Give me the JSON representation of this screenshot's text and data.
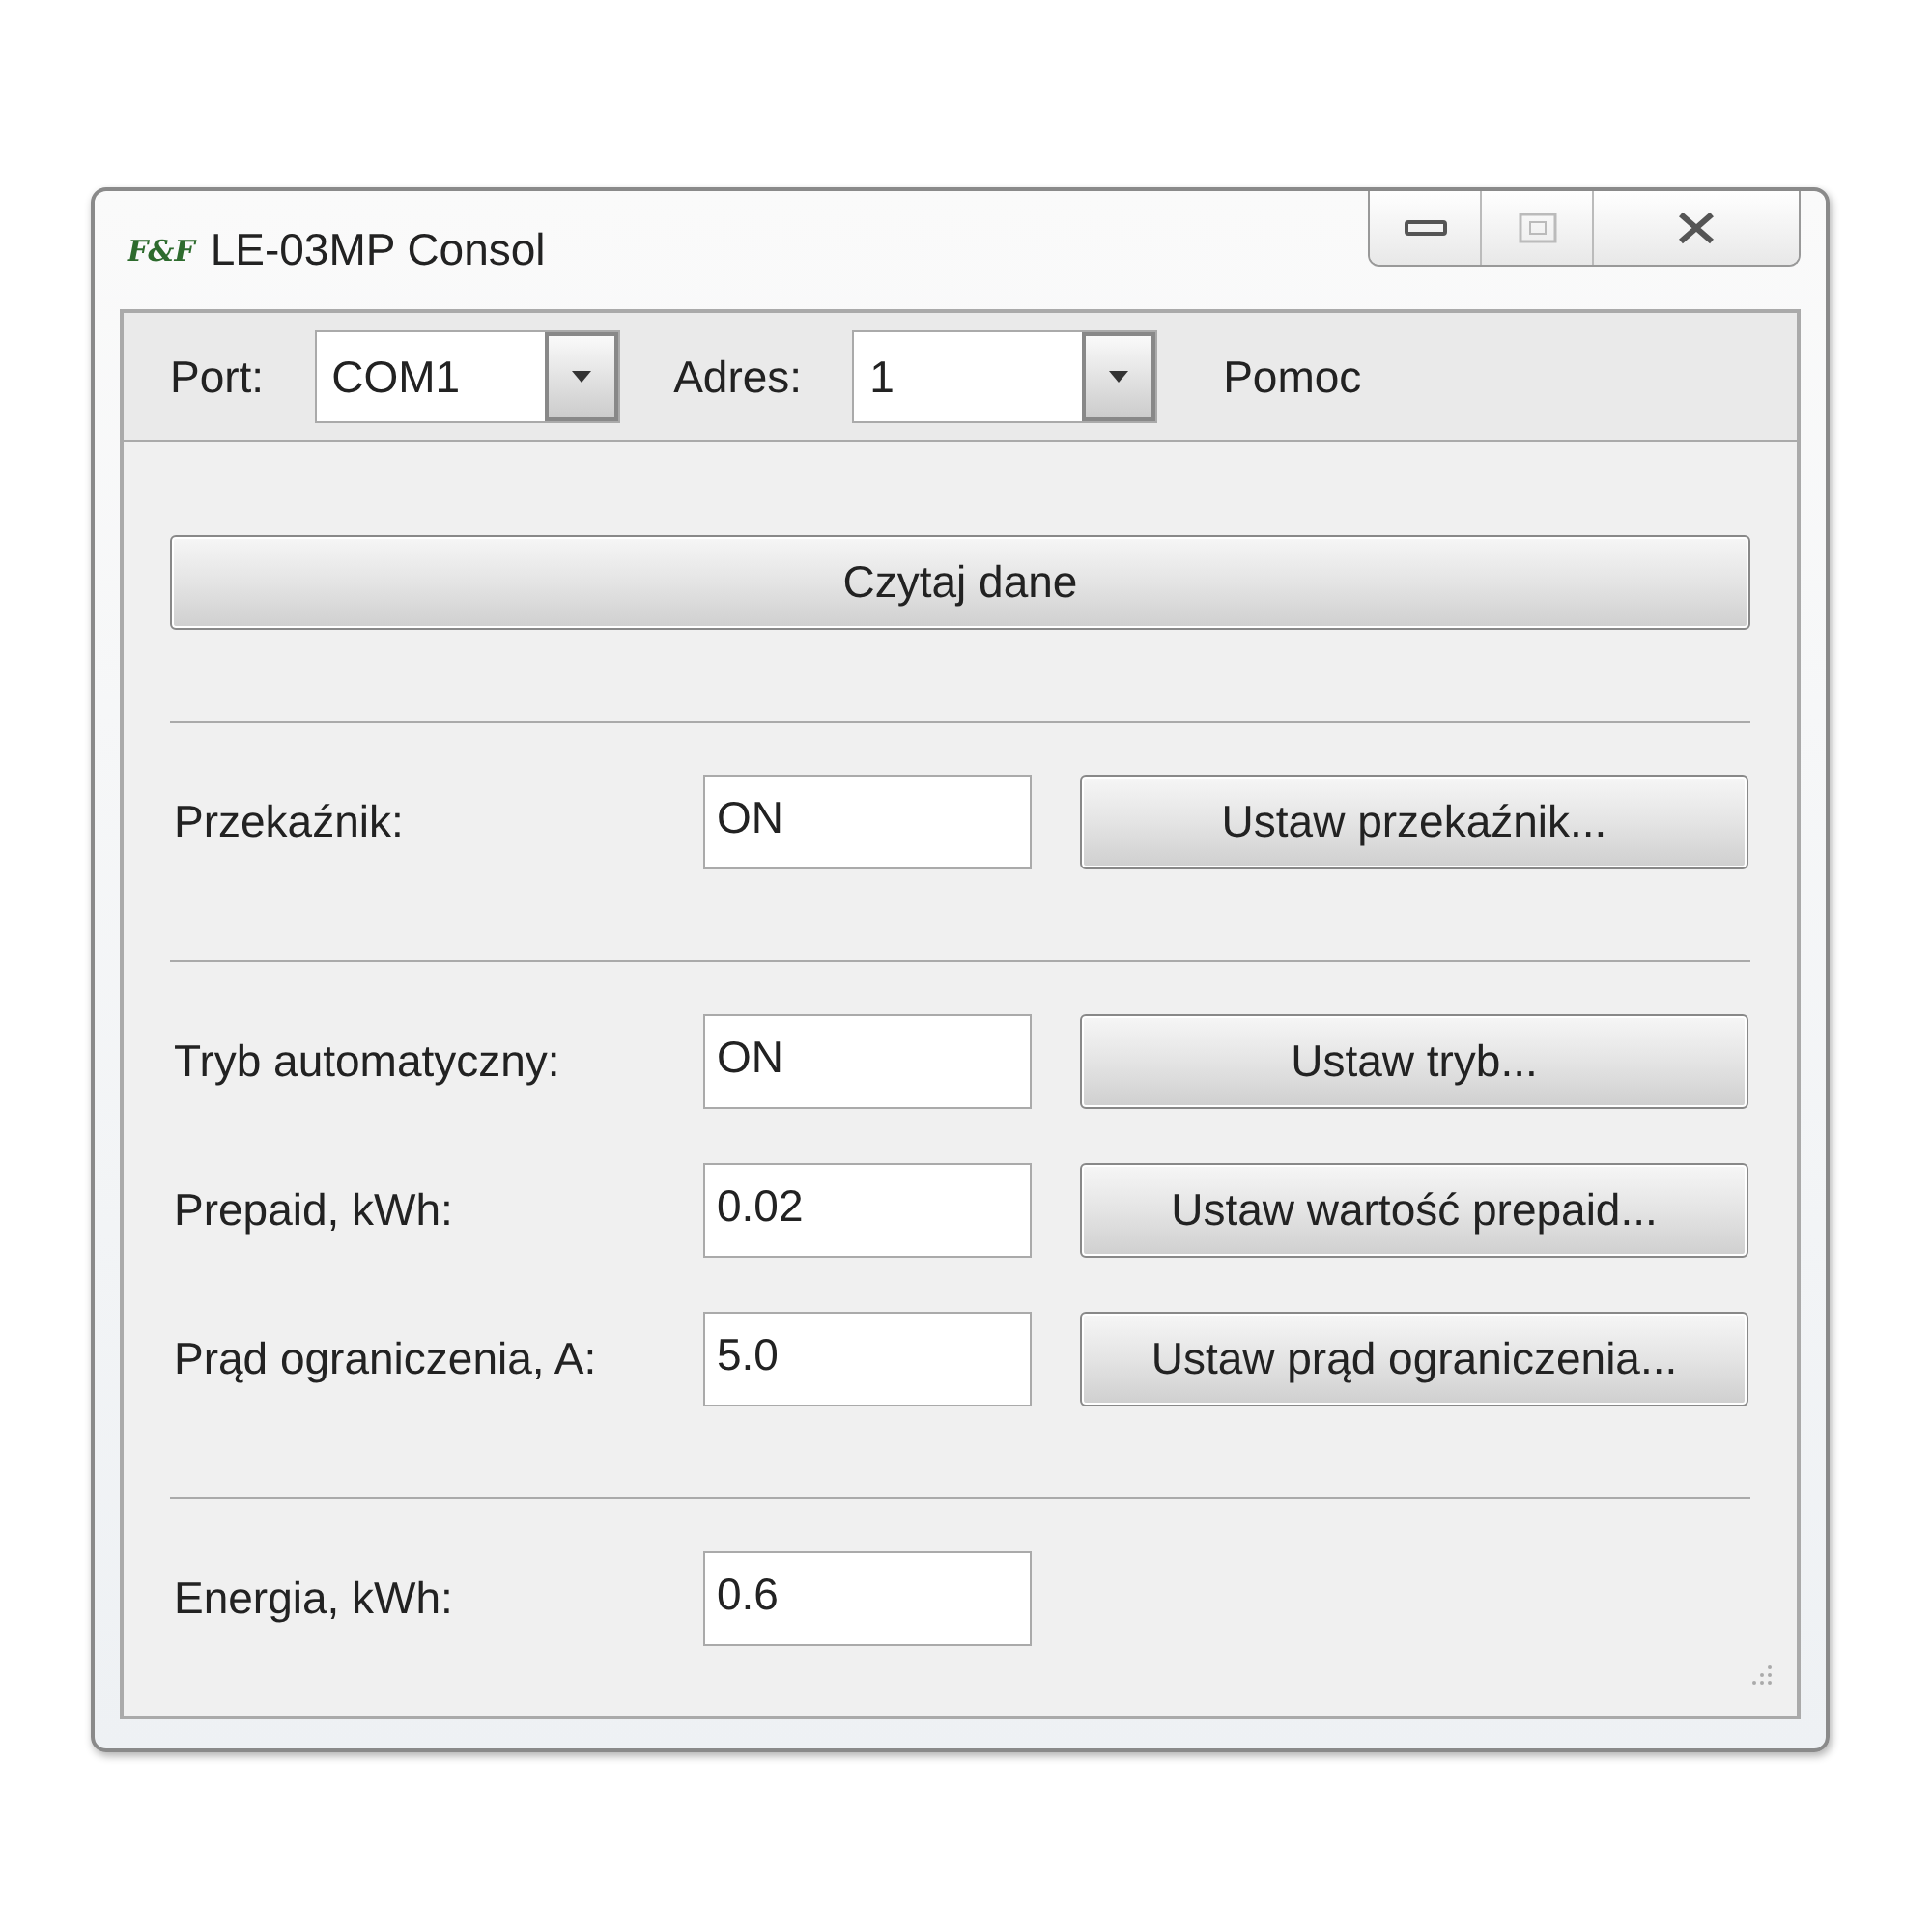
{
  "window": {
    "logo": "F&F",
    "title": "LE-03MP Consol"
  },
  "toolbar": {
    "port_label": "Port:",
    "port_value": "COM1",
    "address_label": "Adres:",
    "address_value": "1",
    "help": "Pomoc"
  },
  "read_button": "Czytaj dane",
  "sections": [
    [
      {
        "label": "Przekaźnik:",
        "value": "ON",
        "button": "Ustaw przekaźnik..."
      }
    ],
    [
      {
        "label": "Tryb automatyczny:",
        "value": "ON",
        "button": "Ustaw tryb..."
      },
      {
        "label": "Prepaid, kWh:",
        "value": "0.02",
        "button": "Ustaw wartość prepaid..."
      },
      {
        "label": "Prąd ograniczenia, A:",
        "value": "5.0",
        "button": "Ustaw prąd ograniczenia..."
      }
    ],
    [
      {
        "label": "Energia, kWh:",
        "value": "0.6"
      }
    ]
  ]
}
